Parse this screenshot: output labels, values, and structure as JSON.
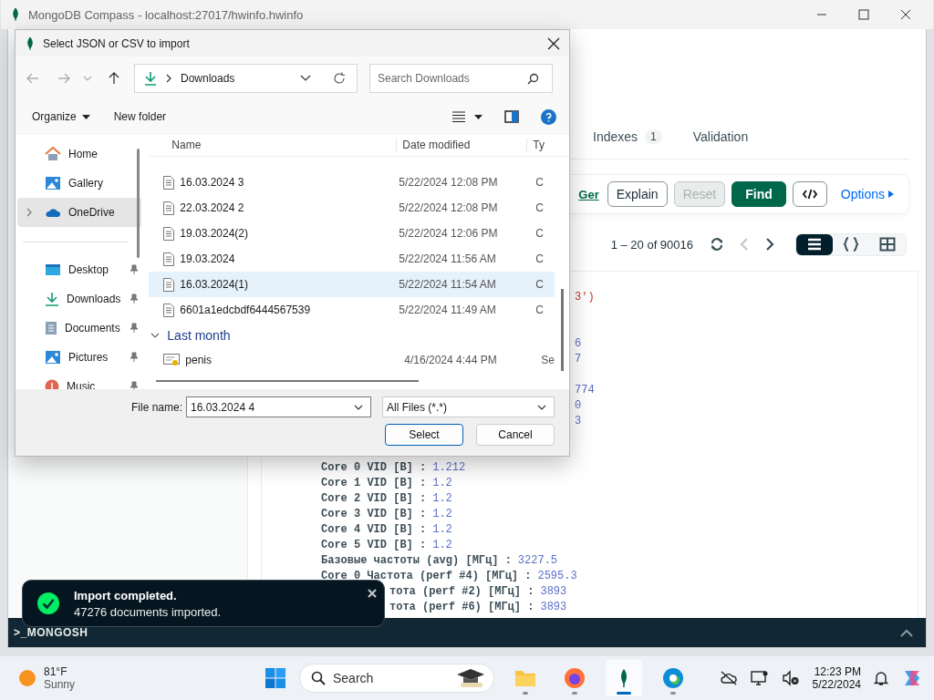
{
  "window": {
    "title": "MongoDB Compass - localhost:27017/hwinfo.hwinfo"
  },
  "collection_tabs": [
    {
      "label": "Indexes",
      "count": "1",
      "selected": false
    },
    {
      "label": "Validation",
      "selected": false
    }
  ],
  "query_bar": {
    "link": "Ger",
    "buttons": [
      {
        "label": "Explain",
        "kind": "outline",
        "disabled": false
      },
      {
        "label": "Reset",
        "kind": "outline",
        "disabled": true
      },
      {
        "label": "Find",
        "kind": "primary",
        "disabled": false
      }
    ],
    "options": "Options"
  },
  "pager": {
    "range": "1 – 20 of 90016",
    "previous": {
      "disabled": true
    },
    "next": {
      "disabled": false
    }
  },
  "view_modes": [
    {
      "kind": "list",
      "selected": true
    },
    {
      "kind": "json",
      "selected": false
    },
    {
      "kind": "table",
      "selected": false
    }
  ],
  "document": {
    "rows": [
      {
        "kind": "string",
        "text": "3')"
      },
      {
        "kind": "blank"
      },
      {
        "kind": "blank"
      },
      {
        "kind": "number",
        "text": "6"
      },
      {
        "kind": "number",
        "text": "7"
      },
      {
        "kind": "blank"
      },
      {
        "kind": "number",
        "text": "774"
      },
      {
        "kind": "number",
        "text": "0"
      },
      {
        "kind": "number",
        "text": "3"
      },
      {
        "kind": "blank"
      },
      {
        "kind": "blank"
      },
      {
        "kind": "field",
        "key": "Core 0 VID [В] :",
        "value": "1.212"
      },
      {
        "kind": "field",
        "key": "Core 1 VID [В] :",
        "value": "1.2"
      },
      {
        "kind": "field",
        "key": "Core 2 VID [В] :",
        "value": "1.2"
      },
      {
        "kind": "field",
        "key": "Core 3 VID [В] :",
        "value": "1.2"
      },
      {
        "kind": "field",
        "key": "Core 4 VID [В] :",
        "value": "1.2"
      },
      {
        "kind": "field",
        "key": "Core 5 VID [В] :",
        "value": "1.2"
      },
      {
        "kind": "field",
        "key": "Базовые частоты (avg) [МГц] :",
        "value": "3227.5"
      },
      {
        "kind": "field",
        "key": "Core 0 Частота (perf #4) [МГц] :",
        "value": "2595.3"
      },
      {
        "kind": "partial",
        "key": "тота (perf #2) [МГц] :",
        "value": "3893"
      },
      {
        "kind": "partial",
        "key": "тота (perf #6) [МГц] :",
        "value": "3893"
      }
    ]
  },
  "shell": {
    "label": ">_MONGOSH"
  },
  "toast": {
    "title": "Import completed.",
    "message": "47276 documents imported."
  },
  "dialog": {
    "title": "Select JSON or CSV to import",
    "address": "Downloads",
    "search_placeholder": "Search Downloads",
    "commands": [
      "Organize",
      "New folder"
    ],
    "nav": [
      {
        "items": [
          {
            "label": "Home",
            "kind": "home",
            "selected": false,
            "pinned": false,
            "expandable": false
          },
          {
            "label": "Gallery",
            "kind": "gallery",
            "selected": false,
            "pinned": false,
            "expandable": false
          },
          {
            "label": "OneDrive",
            "kind": "cloud",
            "selected": true,
            "pinned": false,
            "expandable": true
          }
        ]
      },
      {
        "items": [
          {
            "label": "Desktop",
            "kind": "desktop",
            "selected": false,
            "pinned": true,
            "expandable": false
          },
          {
            "label": "Downloads",
            "kind": "download",
            "selected": false,
            "pinned": true,
            "expandable": false
          },
          {
            "label": "Documents",
            "kind": "documents",
            "selected": false,
            "pinned": true,
            "expandable": false
          },
          {
            "label": "Pictures",
            "kind": "gallery",
            "selected": false,
            "pinned": true,
            "expandable": false
          },
          {
            "label": "Music",
            "kind": "music",
            "selected": false,
            "pinned": true,
            "expandable": false
          }
        ]
      }
    ],
    "columns": [
      "Name",
      "Date modified",
      "Ty"
    ],
    "files": [
      {
        "name": "16.03.2024 3",
        "date": "5/22/2024 12:08 PM",
        "type": "C",
        "kind": "document",
        "hovered": false
      },
      {
        "name": "22.03.2024 2",
        "date": "5/22/2024 12:08 PM",
        "type": "C",
        "kind": "document",
        "hovered": false
      },
      {
        "name": "19.03.2024(2)",
        "date": "5/22/2024 12:06 PM",
        "type": "C",
        "kind": "document",
        "hovered": false
      },
      {
        "name": "19.03.2024",
        "date": "5/22/2024 11:56 AM",
        "type": "C",
        "kind": "document",
        "hovered": false
      },
      {
        "name": "16.03.2024(1)",
        "date": "5/22/2024 11:54 AM",
        "type": "C",
        "kind": "document",
        "hovered": true
      },
      {
        "name": "6601a1edcbdf6444567539",
        "date": "5/22/2024 11:49 AM",
        "type": "C",
        "kind": "document",
        "hovered": false
      }
    ],
    "groups": [
      {
        "label": "Last month",
        "expanded": true,
        "files": [
          {
            "name": "penis",
            "date": "4/16/2024 4:44 PM",
            "type": "Se",
            "kind": "certificate",
            "hovered": false
          }
        ]
      }
    ],
    "file_name_label": "File name:",
    "file_name": "16.03.2024 4",
    "file_type": "All Files (*.*)",
    "buttons": [
      {
        "label": "Select",
        "default": true
      },
      {
        "label": "Cancel",
        "default": false
      }
    ]
  },
  "taskbar": {
    "weather": {
      "temp": "81°F",
      "condition": "Sunny"
    },
    "search_placeholder": "Search",
    "apps": [
      {
        "kind": "explorer",
        "active": false
      },
      {
        "kind": "firefox",
        "active": false
      },
      {
        "kind": "compass",
        "active": true
      },
      {
        "kind": "edge",
        "active": false
      }
    ],
    "time": "12:23 PM",
    "date": "5/22/2024"
  }
}
